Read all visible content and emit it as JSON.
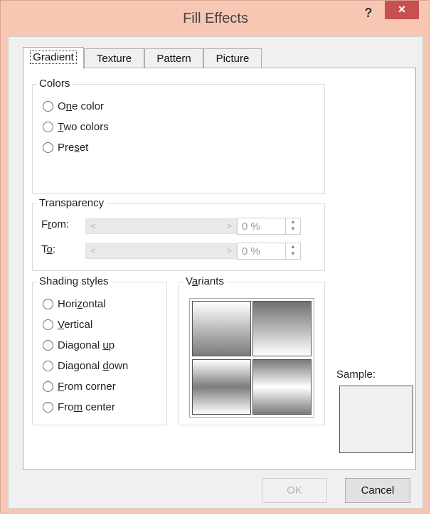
{
  "window": {
    "title": "Fill Effects",
    "help_glyph": "?",
    "close_glyph": "×"
  },
  "tabs": [
    {
      "label": "Gradient",
      "active": true
    },
    {
      "label": "Texture",
      "active": false
    },
    {
      "label": "Pattern",
      "active": false
    },
    {
      "label": "Picture",
      "active": false
    }
  ],
  "colors": {
    "title": "Colors",
    "options": [
      {
        "pre": "O",
        "mn": "n",
        "post": "e color"
      },
      {
        "pre": "",
        "mn": "T",
        "post": "wo colors"
      },
      {
        "pre": "Pre",
        "mn": "s",
        "post": "et"
      }
    ]
  },
  "transparency": {
    "title": "Transparency",
    "from": {
      "pre": "F",
      "mn": "r",
      "post": "om:",
      "value": "0 %",
      "left_arrow": "<",
      "right_arrow": ">"
    },
    "to": {
      "pre": "T",
      "mn": "o",
      "post": ":",
      "value": "0 %",
      "left_arrow": "<",
      "right_arrow": ">"
    }
  },
  "shading": {
    "title": "Shading styles",
    "options": [
      {
        "pre": "Hori",
        "mn": "z",
        "post": "ontal"
      },
      {
        "pre": "",
        "mn": "V",
        "post": "ertical"
      },
      {
        "pre": "Diagonal ",
        "mn": "u",
        "post": "p"
      },
      {
        "pre": "Diagonal ",
        "mn": "d",
        "post": "own"
      },
      {
        "pre": "",
        "mn": "F",
        "post": "rom corner"
      },
      {
        "pre": "Fro",
        "mn": "m",
        "post": " center"
      }
    ]
  },
  "variants": {
    "pre": "V",
    "mn": "a",
    "post": "riants"
  },
  "sample": {
    "label": "Sample:"
  },
  "buttons": {
    "ok": "OK",
    "cancel": "Cancel"
  },
  "theme": {
    "accent": "#c75050",
    "frame": "#f7c7b4",
    "dialog_bg": "#f0f0f0"
  }
}
